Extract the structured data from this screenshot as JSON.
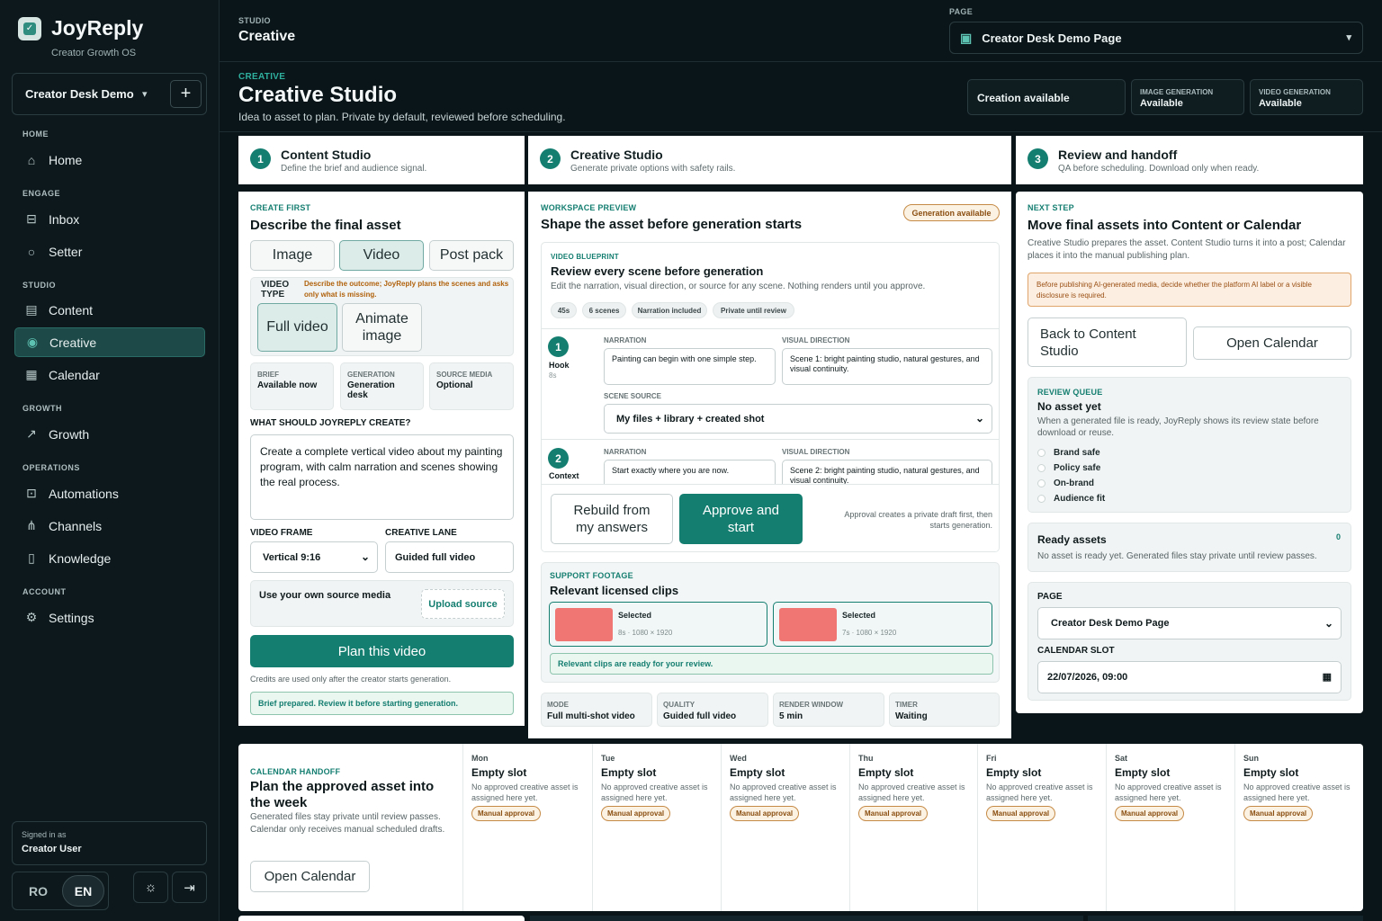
{
  "app": {
    "name": "JoyReply",
    "tagline": "Creator Growth OS"
  },
  "workspace": {
    "name": "Creator Desk Demo",
    "add_label": "+"
  },
  "nav": {
    "home_heading": "HOME",
    "engage_heading": "ENGAGE",
    "studio_heading": "STUDIO",
    "growth_heading": "GROWTH",
    "operations_heading": "OPERATIONS",
    "account_heading": "ACCOUNT",
    "items": {
      "home": "Home",
      "inbox": "Inbox",
      "setter": "Setter",
      "content": "Content",
      "creative": "Creative",
      "calendar": "Calendar",
      "growth": "Growth",
      "automations": "Automations",
      "channels": "Channels",
      "knowledge": "Knowledge",
      "settings": "Settings"
    }
  },
  "user": {
    "signed_in_label": "Signed in as",
    "name": "Creator User"
  },
  "lang": {
    "ro": "RO",
    "en": "EN"
  },
  "top": {
    "studio_label": "STUDIO",
    "studio_value": "Creative",
    "page_label": "PAGE",
    "page_value": "Creator Desk Demo Page"
  },
  "hero": {
    "kicker": "CREATIVE",
    "title": "Creative Studio",
    "subtitle": "Idea to asset to plan. Private by default, reviewed before scheduling.",
    "creation": "Creation available",
    "image_gen_label": "IMAGE GENERATION",
    "image_gen_value": "Available",
    "video_gen_label": "VIDEO GENERATION",
    "video_gen_value": "Available"
  },
  "steps": [
    {
      "num": "1",
      "title": "Content Studio",
      "sub": "Define the brief and audience signal."
    },
    {
      "num": "2",
      "title": "Creative Studio",
      "sub": "Generate private options with safety rails."
    },
    {
      "num": "3",
      "title": "Review and handoff",
      "sub": "QA before scheduling. Download only when ready."
    }
  ],
  "create": {
    "kicker": "CREATE FIRST",
    "title": "Describe the final asset",
    "tabs": [
      "Image",
      "Video",
      "Post pack"
    ],
    "video_type_label": "VIDEO TYPE",
    "video_type_hint": "Describe the outcome; JoyReply plans the scenes and asks only what is missing.",
    "type_full": "Full video",
    "type_animate": "Animate image",
    "brief_label": "BRIEF",
    "brief_value": "Available now",
    "generation_label": "GENERATION",
    "generation_value": "Generation desk",
    "source_label": "SOURCE MEDIA",
    "source_value": "Optional",
    "prompt_label": "WHAT SHOULD JOYREPLY CREATE?",
    "prompt_value": "Create a complete vertical video about my painting program, with calm narration and scenes showing the real process.",
    "frame_label": "VIDEO FRAME",
    "frame_value": "Vertical 9:16",
    "lane_label": "CREATIVE LANE",
    "lane_value": "Guided full video",
    "own_media": "Use your own source media",
    "upload": "Upload source",
    "plan": "Plan this video",
    "credits_note": "Credits are used only after the creator starts generation.",
    "brief_ready": "Brief prepared. Review it before starting generation."
  },
  "workspace_preview": {
    "kicker": "WORKSPACE PREVIEW",
    "title": "Shape the asset before generation starts",
    "badge": "Generation available",
    "bp_kicker": "VIDEO BLUEPRINT",
    "bp_title": "Review every scene before generation",
    "bp_sub": "Edit the narration, visual direction, or source for any scene. Nothing renders until you approve.",
    "pills": [
      "45s",
      "6 scenes",
      "Narration included",
      "Private until review"
    ],
    "scenes": [
      {
        "num": "1",
        "name": "Hook",
        "dur": "8s",
        "narration_label": "NARRATION",
        "narration": "Painting can begin with one simple step.",
        "visual_label": "VISUAL DIRECTION",
        "visual": "Scene 1: bright painting studio, natural gestures, and visual continuity.",
        "source_label": "SCENE SOURCE",
        "source": "My files + library + created shot"
      },
      {
        "num": "2",
        "name": "Context",
        "narration_label": "NARRATION",
        "narration": "Start exactly where you are now.",
        "visual_label": "VISUAL DIRECTION",
        "visual": "Scene 2: bright painting studio, natural gestures, and visual continuity."
      }
    ],
    "rebuild": "Rebuild from my answers",
    "approve": "Approve and start",
    "approve_note": "Approval creates a private draft first, then starts generation.",
    "support_kicker": "SUPPORT FOOTAGE",
    "support_title": "Relevant licensed clips",
    "clips": [
      {
        "status": "Selected",
        "meta": "8s · 1080 × 1920",
        "color": "#ef7673"
      },
      {
        "status": "Selected",
        "meta": "7s · 1080 × 1920",
        "color": "#ef7673"
      }
    ],
    "clips_ready": "Relevant clips are ready for your review.",
    "mode_label": "MODE",
    "mode_value": "Full multi-shot video",
    "quality_label": "QUALITY",
    "quality_value": "Guided full video",
    "render_label": "RENDER WINDOW",
    "render_value": "5 min",
    "timer_label": "TIMER",
    "timer_value": "Waiting"
  },
  "handoff": {
    "kicker": "NEXT STEP",
    "title": "Move final assets into Content or Calendar",
    "sub": "Creative Studio prepares the asset. Content Studio turns it into a post; Calendar places it into the manual publishing plan.",
    "warning": "Before publishing AI-generated media, decide whether the platform AI label or a visible disclosure is required.",
    "back": "Back to Content Studio",
    "open_calendar": "Open Calendar",
    "rq_kicker": "REVIEW QUEUE",
    "rq_title": "No asset yet",
    "rq_sub": "When a generated file is ready, JoyReply shows its review state before download or reuse.",
    "checks": [
      "Brand safe",
      "Policy safe",
      "On-brand",
      "Audience fit"
    ],
    "ready_title": "Ready assets",
    "ready_count": "0",
    "ready_sub": "No asset is ready yet. Generated files stay private until review passes.",
    "page_label": "PAGE",
    "page_value": "Creator Desk Demo Page",
    "slot_label": "CALENDAR SLOT",
    "slot_value": "22/07/2026, 09:00"
  },
  "calendar": {
    "kicker": "CALENDAR HANDOFF",
    "title": "Plan the approved asset into the week",
    "sub": "Generated files stay private until review passes. Calendar only receives manual scheduled drafts.",
    "open": "Open Calendar",
    "days": [
      {
        "day": "Mon",
        "empty": "Empty slot",
        "desc": "No approved creative asset is assigned here yet.",
        "badge": "Manual approval"
      },
      {
        "day": "Tue",
        "empty": "Empty slot",
        "desc": "No approved creative asset is assigned here yet.",
        "badge": "Manual approval"
      },
      {
        "day": "Wed",
        "empty": "Empty slot",
        "desc": "No approved creative asset is assigned here yet.",
        "badge": "Manual approval"
      },
      {
        "day": "Thu",
        "empty": "Empty slot",
        "desc": "No approved creative asset is assigned here yet.",
        "badge": "Manual approval"
      },
      {
        "day": "Fri",
        "empty": "Empty slot",
        "desc": "No approved creative asset is assigned here yet.",
        "badge": "Manual approval"
      },
      {
        "day": "Sat",
        "empty": "Empty slot",
        "desc": "No approved creative asset is assigned here yet.",
        "badge": "Manual approval"
      },
      {
        "day": "Sun",
        "empty": "Empty slot",
        "desc": "No approved creative asset is assigned here yet.",
        "badge": "Manual approval"
      }
    ]
  },
  "colors": {
    "accent": "#147e70",
    "sidebar_bg": "#0c181c",
    "warning": "#c58a45"
  }
}
